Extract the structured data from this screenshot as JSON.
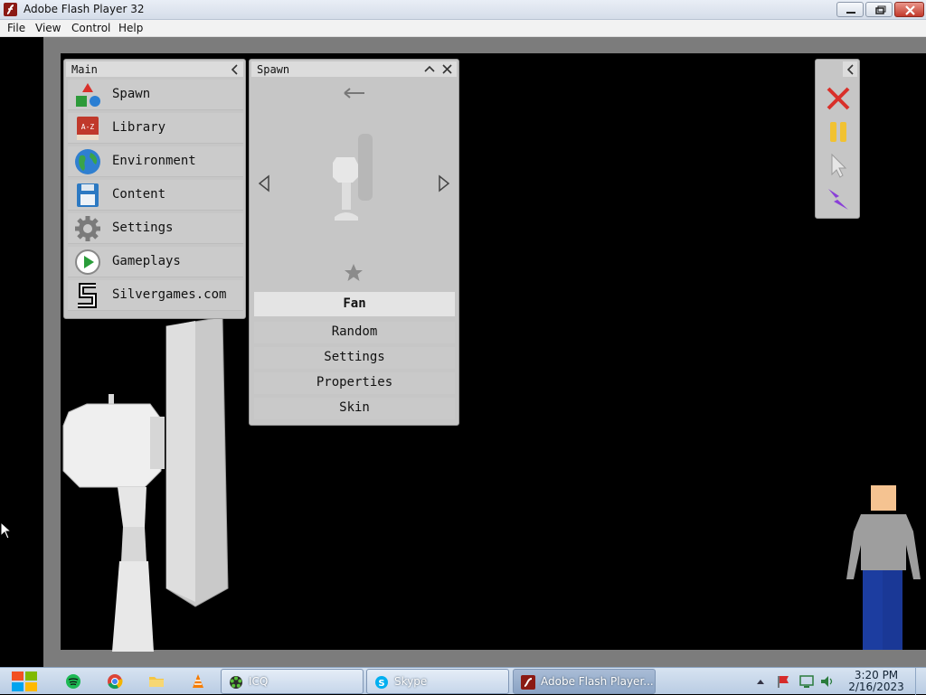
{
  "window": {
    "title": "Adobe Flash Player 32"
  },
  "menu": {
    "items": [
      "File",
      "View",
      "Control",
      "Help"
    ]
  },
  "main_panel": {
    "title": "Main",
    "items": [
      {
        "label": "Spawn",
        "icon": "shapes-icon"
      },
      {
        "label": "Library",
        "icon": "book-az-icon"
      },
      {
        "label": "Environment",
        "icon": "globe-icon"
      },
      {
        "label": "Content",
        "icon": "floppy-disk-icon"
      },
      {
        "label": "Settings",
        "icon": "gear-icon"
      },
      {
        "label": "Gameplays",
        "icon": "play-icon"
      },
      {
        "label": "Silvergames.com",
        "icon": "silvergames-logo-icon"
      }
    ]
  },
  "spawn_panel": {
    "title": "Spawn",
    "selected": "Fan",
    "options": [
      "Random",
      "Settings",
      "Properties",
      "Skin"
    ]
  },
  "tools_panel": {
    "tools": [
      "close-x-icon",
      "pause-icon",
      "cursor-icon",
      "lightning-icon"
    ]
  },
  "taskbar": {
    "apps": [
      "ICQ",
      "Skype",
      "Adobe Flash Player..."
    ],
    "time": "3:20 PM",
    "date": "2/16/2023"
  },
  "colors": {
    "panel_bg": "#c6c6c6",
    "selected_bg": "#e4e4e4",
    "frame_gray": "#7c7c7c",
    "close_red": "#d9302a",
    "pause_yellow": "#f1c232",
    "lightning_purple": "#8a3fd8"
  }
}
